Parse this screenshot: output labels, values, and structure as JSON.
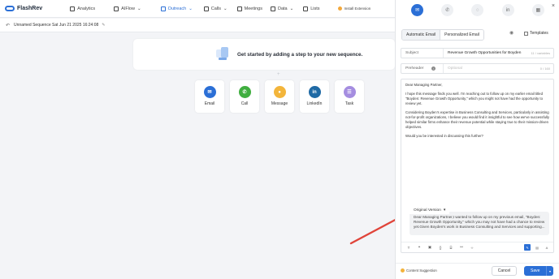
{
  "app": {
    "brand": "FlashRev"
  },
  "nav": {
    "items": [
      {
        "label": "Analytics",
        "icon": "analytics-icon"
      },
      {
        "label": "AIFlow",
        "icon": "aiflow-icon",
        "caret": "⌄"
      },
      {
        "label": "Outreach",
        "icon": "outreach-icon",
        "caret": "⌄",
        "active": true
      },
      {
        "label": "Calls",
        "icon": "calls-icon",
        "caret": "⌄"
      },
      {
        "label": "Meetings",
        "icon": "meetings-icon"
      },
      {
        "label": "Data",
        "icon": "data-icon",
        "caret": "⌄"
      },
      {
        "label": "Lists",
        "icon": "lists-icon"
      }
    ],
    "install_label": "Install Extension"
  },
  "sequence": {
    "title": "Unnamed Sequence Sat Jun 21 2025 16:24:08"
  },
  "get_started": {
    "text": "Get started by adding a step to your new sequence."
  },
  "steps": [
    {
      "label": "Email",
      "color": "#2b6fd6",
      "glyph": "✉"
    },
    {
      "label": "Call",
      "color": "#3fae3f",
      "glyph": "✆"
    },
    {
      "label": "Message",
      "color": "#f3b53b",
      "glyph": "●"
    },
    {
      "label": "LinkedIn",
      "color": "#1f6aa5",
      "glyph": "in"
    },
    {
      "label": "Task",
      "color": "#a58de0",
      "glyph": "☰"
    }
  ],
  "panel": {
    "channels": [
      {
        "name": "email-channel",
        "glyph": "✉",
        "active": true
      },
      {
        "name": "call-channel",
        "glyph": "✆"
      },
      {
        "name": "message-channel",
        "glyph": "◌"
      },
      {
        "name": "linkedin-channel",
        "glyph": "in"
      },
      {
        "name": "task-channel",
        "glyph": "▦"
      }
    ],
    "tabs": {
      "automatic": "Automatic Email",
      "personalized": "Personalized Email"
    },
    "templates_label": "Templates",
    "subject": {
      "label": "Subject",
      "value": "Revenue Growth Opportunities for Boyden",
      "count": "11 / variables"
    },
    "preheader": {
      "label": "Preheader",
      "placeholder": "Optional",
      "count": "0 / 160"
    },
    "body": [
      "Dear Managing Partner,",
      "I hope this message finds you well. I'm reaching out to follow up on my earlier email titled \"Boyden: Revenue Growth Opportunity,\" which you might not have had the opportunity to review yet.",
      "Considering Boyden's expertise in Business Consulting and Services, particularly in assisting not-for-profit organizations, I believe you would find it insightful to see how we've successfully helped similar firms enhance their revenue potential while staying true to their mission-driven objectives.",
      "Would you be interested in discussing this further?"
    ],
    "original_version_label": "Original Version",
    "suggestion_text": "Dear Managing Partner,I wanted to follow up on my previous email, \"Boyden: Revenue Growth Opportunity,\" which you may not have had a chance to review yet.Given Boyden's work in Business Consulting and Services and supporting...",
    "content_suggestion_label": "Content Suggestion",
    "cancel_label": "Cancel",
    "save_label": "Save"
  }
}
